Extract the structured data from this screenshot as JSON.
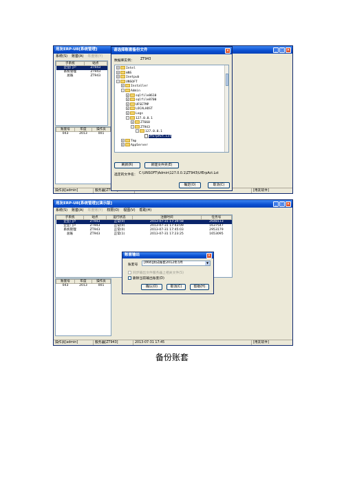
{
  "colors": {
    "title_blue": "#0a4fd1",
    "selection": "#0a246a",
    "close_red": "#d9532c",
    "folder": "#f3d36a"
  },
  "screen1": {
    "main_title": "用友ERP-U8[系统管理]",
    "menu": [
      "系统(S)",
      "账套(A)",
      "年度账(Y)"
    ],
    "table_headers": [
      "子系统",
      "站点"
    ],
    "rows": [
      [
        "企业门户",
        "ZT943"
      ],
      [
        "系统管理",
        "ZT943"
      ],
      [
        "总账",
        "ZT943"
      ]
    ],
    "lower_headers": [
      "账套号",
      "年度",
      "操作员"
    ],
    "lower_rows": [
      [
        "043",
        "2013",
        "001"
      ]
    ],
    "status": [
      "操作员[admin]",
      "服务器[ZT943]",
      "",
      "[用友软件]"
    ],
    "dialog": {
      "title": "请选择账套备份文件",
      "db_label": "数据库实例：",
      "db_value": "ZT943",
      "tree": [
        {
          "level": 0,
          "type": "folder",
          "exp": "+",
          "label": "Intel"
        },
        {
          "level": 0,
          "type": "folder",
          "exp": "+",
          "label": "mNS"
        },
        {
          "level": 0,
          "type": "folder",
          "exp": "+",
          "label": "Inetpub"
        },
        {
          "level": 0,
          "type": "folder",
          "exp": "-",
          "label": "UNSOFT"
        },
        {
          "level": 1,
          "type": "folder",
          "exp": "+",
          "label": "Installer"
        },
        {
          "level": 1,
          "type": "folder",
          "exp": "-",
          "label": "Admin"
        },
        {
          "level": 2,
          "type": "folder",
          "exp": "+",
          "label": "sqlfile8610"
        },
        {
          "level": 2,
          "type": "folder",
          "exp": "+",
          "label": "sqlfile8700"
        },
        {
          "level": 2,
          "type": "folder",
          "exp": "+",
          "label": "UFSETMP"
        },
        {
          "level": 2,
          "type": "folder",
          "exp": "+",
          "label": "LOCALHOST"
        },
        {
          "level": 2,
          "type": "folder",
          "exp": "+",
          "label": "Logs"
        },
        {
          "level": 2,
          "type": "folder",
          "exp": "-",
          "label": "127.0.0.1"
        },
        {
          "level": 3,
          "type": "folder",
          "exp": "+",
          "label": "ZT660"
        },
        {
          "level": 3,
          "type": "folder",
          "exp": "-",
          "label": "ZT943"
        },
        {
          "level": 4,
          "type": "folder",
          "exp": "-",
          "label": "127.0.0.1"
        },
        {
          "level": 5,
          "type": "file",
          "exp": "",
          "label": "UfErpAct.Lst",
          "selected": true
        },
        {
          "level": 1,
          "type": "folder",
          "exp": "+",
          "label": "Tmp"
        },
        {
          "level": 1,
          "type": "folder",
          "exp": "+",
          "label": "AppServer"
        }
      ],
      "refresh_label": "刷新(R)",
      "new_folder_label": "新建文件夹(E)",
      "selected_file_label": "选定的文件名：",
      "selected_file_value": "C:\\UNSOFT\\Admin\\127.0.0.1\\ZT943\\UfErpAct.Lst",
      "ok_label": "确定(O)",
      "cancel_label": "取消(C)"
    }
  },
  "screen2": {
    "main_title": "用友ERP-U8[系统管理][演示版]",
    "menu": [
      "系统(S)",
      "账套(A)",
      "年度账(Y)",
      "权限(O)",
      "视图(V)",
      "帮助(H)"
    ],
    "table_headers": [
      "子系统",
      "站点",
      "运行状态",
      "注册时间",
      "任务号"
    ],
    "rows": [
      [
        "企业门户",
        "ZT943",
        "正常(0)",
        "2013-07-31 17:39:58",
        "2648113"
      ],
      [
        "企业门户",
        "ZT943",
        "正常(0)",
        "2013-07-31 17:43:09",
        "1637547"
      ],
      [
        "系统管理",
        "ZT943",
        "正常(0)",
        "2013-07-31 17:45:03",
        "2953179"
      ],
      [
        "总账",
        "ZT943",
        "正常(1)",
        "2013-07-31 17:23:25",
        "1653095"
      ]
    ],
    "lower_headers": [
      "账套号",
      "年度",
      "操作员"
    ],
    "lower_rows": [
      [
        "043",
        "2013",
        "001"
      ]
    ],
    "status": [
      "操作员[admin]",
      "服务器[ZT943]",
      "2013-07-31 17:45",
      "[用友软件]"
    ],
    "dialog": {
      "title": "账套输出",
      "acct_label": "账套号",
      "acct_value": "[868]测试账套2012年3月",
      "opt1": "同步输出文件服务器上相关文件(S)",
      "opt2": "删除当前输出账套(D)",
      "ok_label": "确认(O)",
      "cancel_label": "取消(C)",
      "help_label": "帮助(H)"
    }
  },
  "caption": "备份账套"
}
